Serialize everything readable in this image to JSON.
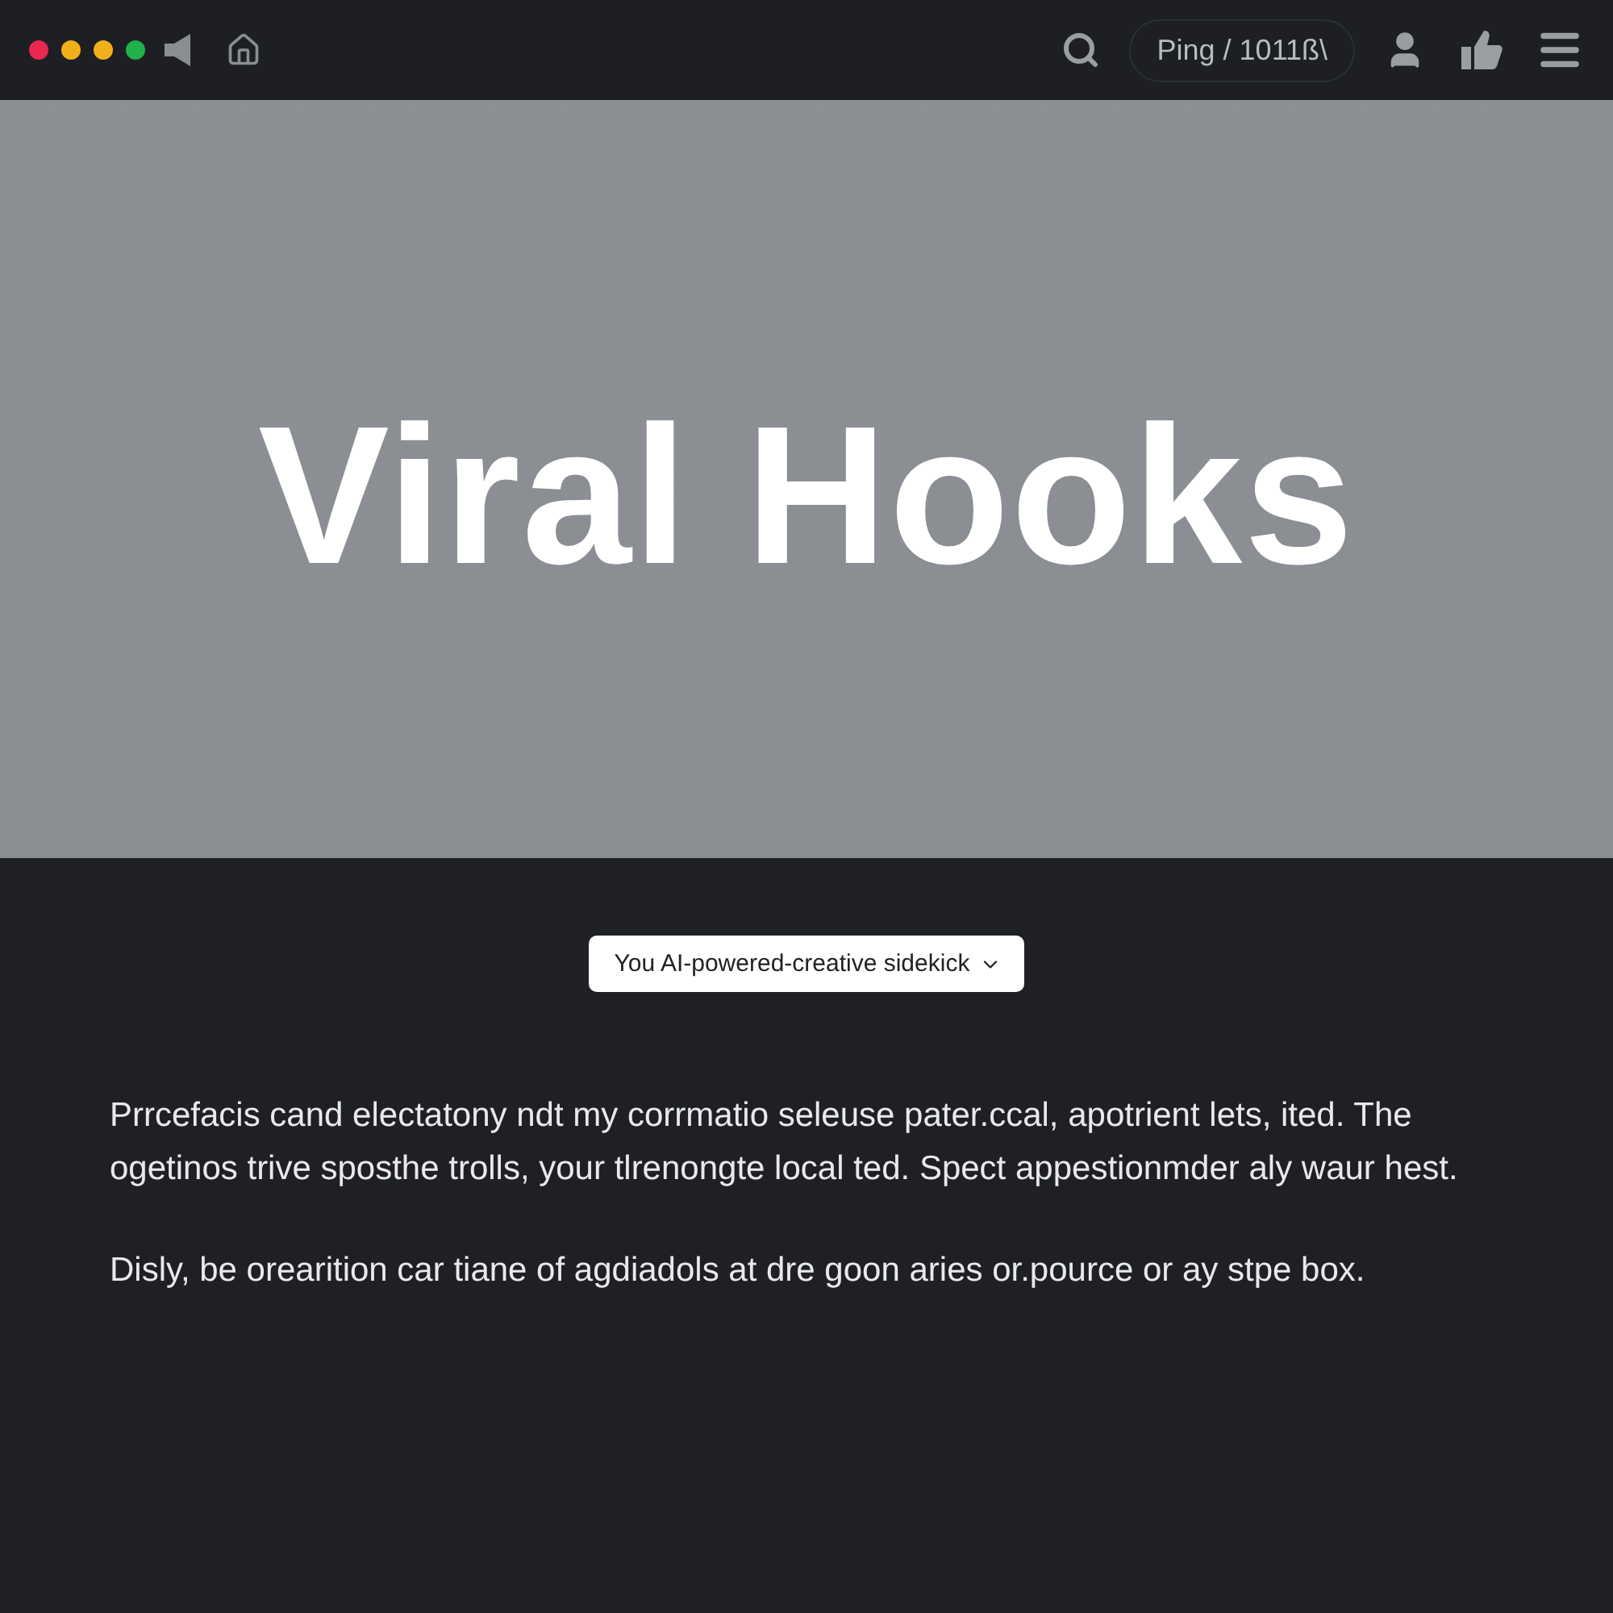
{
  "topbar": {
    "window_dots": [
      {
        "color": "#e8284f"
      },
      {
        "color": "#f0b01a"
      },
      {
        "color": "#f0b01a"
      },
      {
        "color": "#22b04a"
      }
    ],
    "ping": "Ping / 1011ß\\"
  },
  "hero": {
    "title": "Viral Hooks"
  },
  "tagline_dropdown": {
    "label": "You AI-powered-creative sidekick"
  },
  "paragraphs": [
    "Prrcefacis cand electatony ndt my corrmatio seleuse pater.ccal, apotrient lets, ited. The ogetinos trive sposthe trolls, your tlrenongte local ted. Spect appestionmder aly waur hest.",
    "Disly, be orearition car tiane of agdiadols at dre goon aries or.pource or ay stpe box."
  ]
}
